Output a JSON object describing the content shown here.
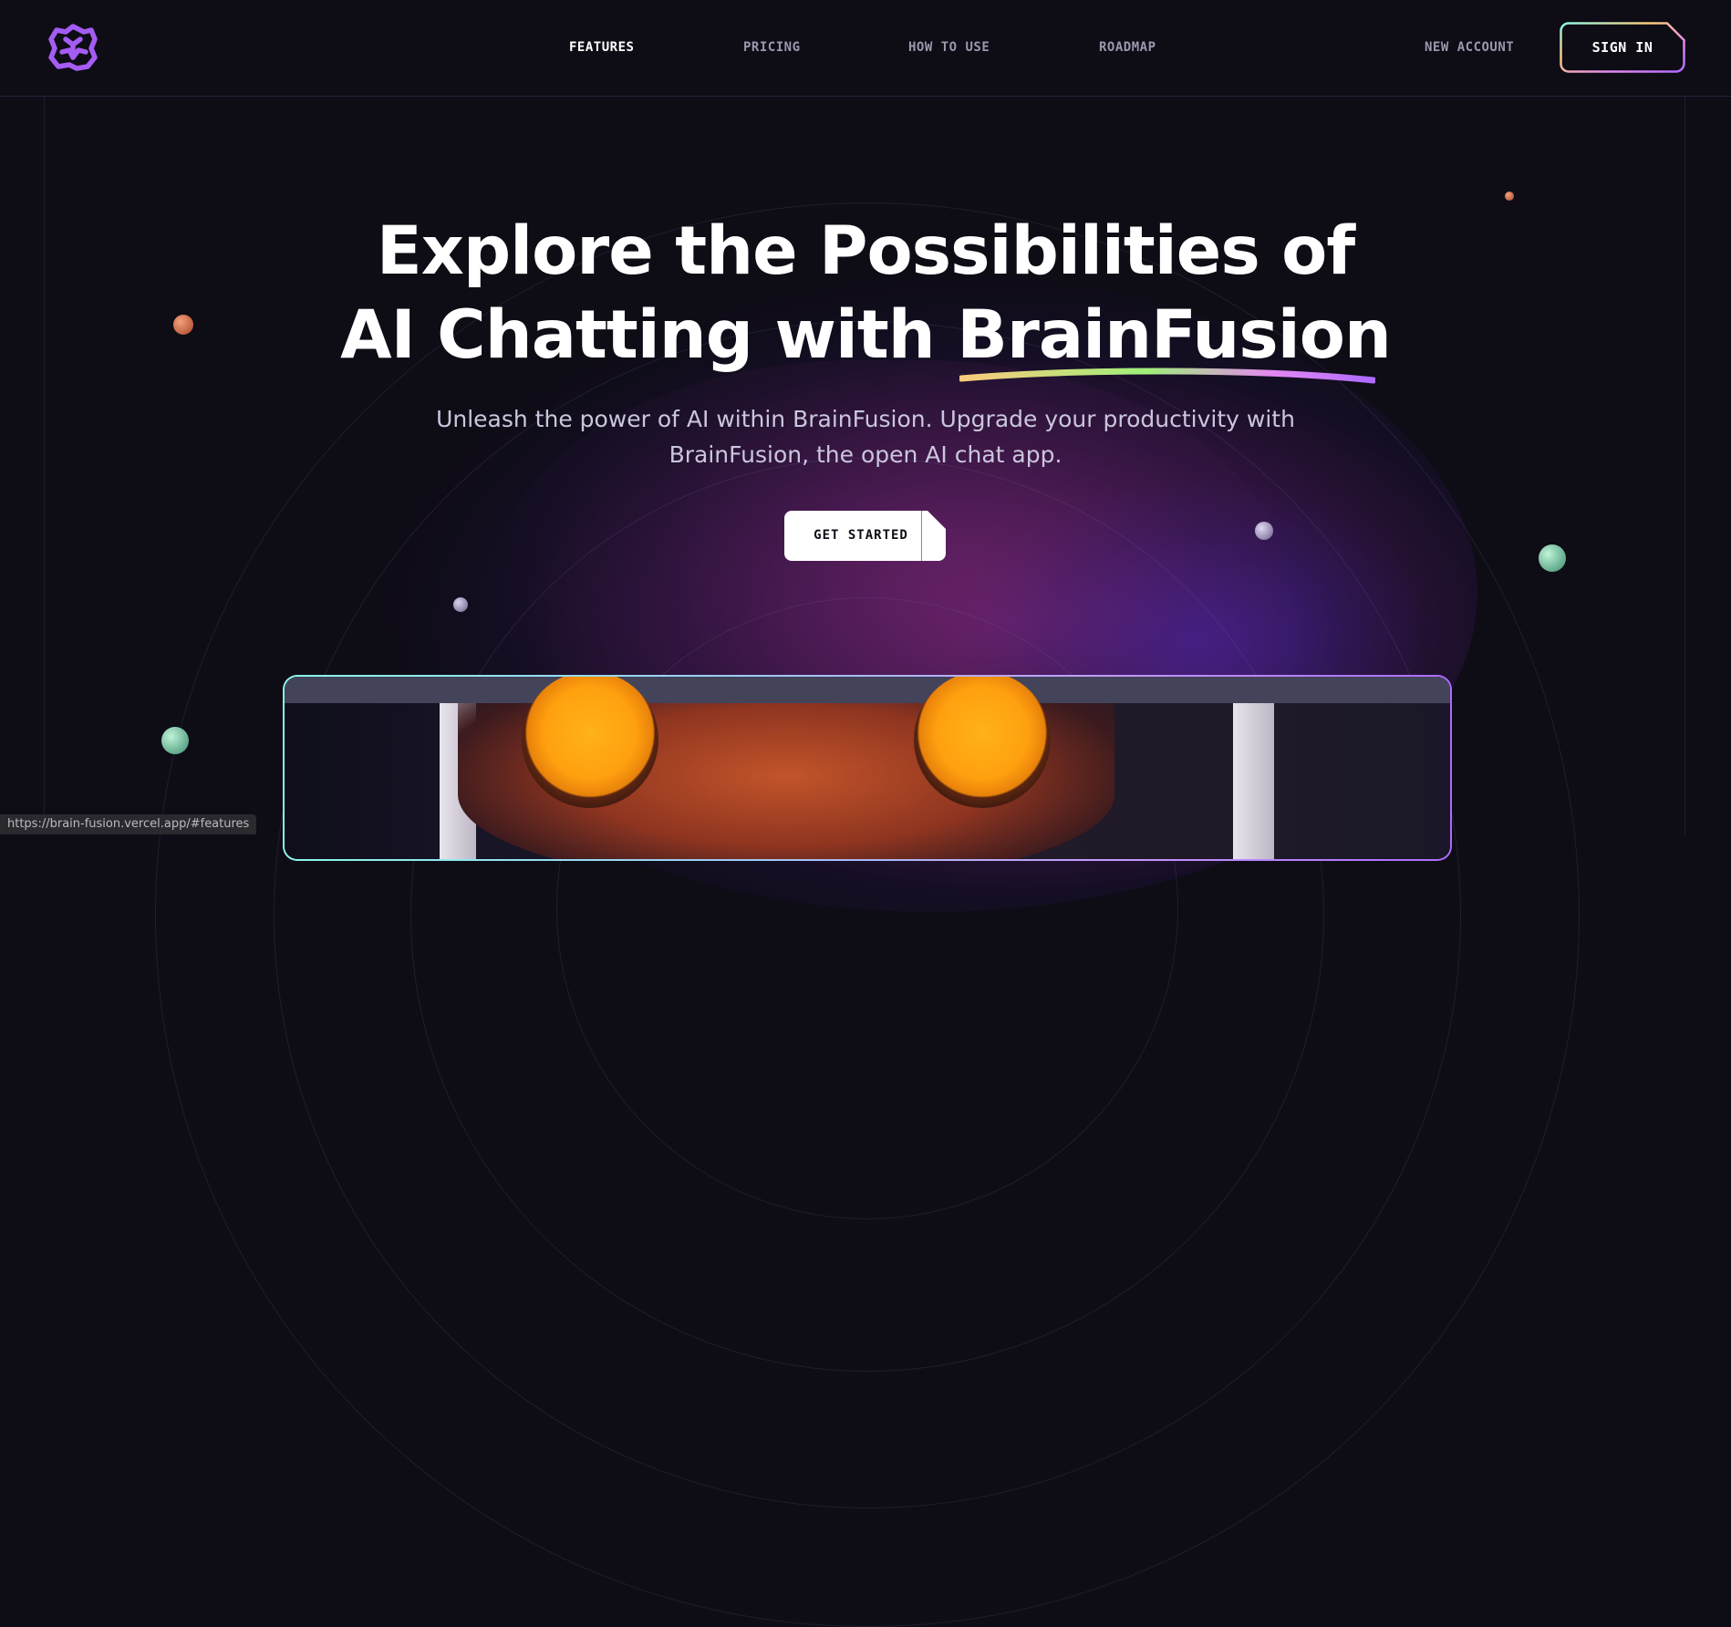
{
  "brand": {
    "logo_icon": "brainfusion-brain-logo-icon",
    "accent": "#ac6aff"
  },
  "nav": {
    "items": [
      {
        "label": "FEATURES",
        "active": true
      },
      {
        "label": "PRICING",
        "active": false
      },
      {
        "label": "HOW TO USE",
        "active": false
      },
      {
        "label": "ROADMAP",
        "active": false
      }
    ],
    "new_account": "NEW ACCOUNT",
    "sign_in": "SIGN IN"
  },
  "hero": {
    "title_line1": "Explore the Possibilities of",
    "title_line2_prefix": "AI Chatting with ",
    "title_highlight": "BrainFusion",
    "subtitle_line1": "Unleash the power of AI within BrainFusion. Upgrade your productivity with",
    "subtitle_line2": "BrainFusion, the open AI chat app.",
    "cta": "GET STARTED"
  },
  "status_bar": {
    "url": "https://brain-fusion.vercel.app/#features"
  },
  "colors": {
    "background": "#0e0c15",
    "nav_inactive": "#9a98ad",
    "gradient": [
      "#89f9e8",
      "#facb7b",
      "#ac6aff"
    ]
  }
}
